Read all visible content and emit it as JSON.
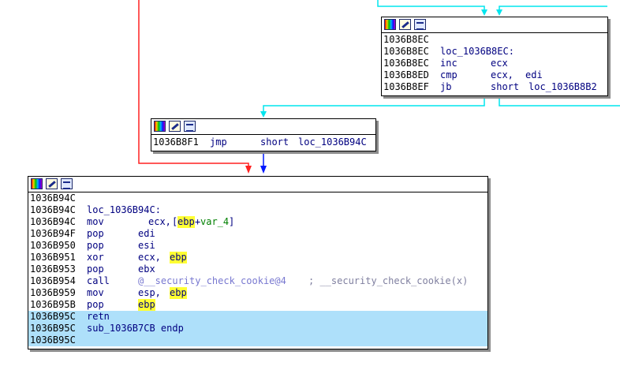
{
  "colors": {
    "edge_cyan": "#00e5ee",
    "edge_red": "#ff2020",
    "edge_blue": "#0018ff",
    "register_highlight": "#ffff33",
    "selected_row": "#aee0fa"
  },
  "node_toolbar_icons": [
    "color-palette-icon",
    "edit-node-icon",
    "graph-overview-icon"
  ],
  "node_a": {
    "lines": [
      {
        "addr": "1036B8EC"
      },
      {
        "addr": "1036B8EC",
        "label": "loc_1036B8EC:"
      },
      {
        "addr": "1036B8EC",
        "mnem": "inc",
        "op1": "ecx"
      },
      {
        "addr": "1036B8ED",
        "mnem": "cmp",
        "op1": "ecx,",
        "op2": "edi"
      },
      {
        "addr": "1036B8EF",
        "mnem": "jb",
        "op1": "short",
        "op2": "loc_1036B8B2"
      }
    ]
  },
  "node_b": {
    "lines": [
      {
        "addr": "1036B8F1",
        "mnem": "jmp",
        "op1": "short",
        "op2": "loc_1036B94C"
      }
    ]
  },
  "node_c": {
    "lines": [
      {
        "addr": "1036B94C"
      },
      {
        "addr": "1036B94C",
        "label": "loc_1036B94C:"
      },
      {
        "addr": "1036B94C",
        "mnem": "mov",
        "op1": "ecx,",
        "mem_open": "[",
        "reg": "ebp",
        "plus": "+",
        "var": "var_4",
        "mem_close": "]"
      },
      {
        "addr": "1036B94F",
        "mnem": "pop",
        "op1": "edi"
      },
      {
        "addr": "1036B950",
        "mnem": "pop",
        "op1": "esi"
      },
      {
        "addr": "1036B951",
        "mnem": "xor",
        "op1": "ecx,",
        "reg": "ebp"
      },
      {
        "addr": "1036B953",
        "mnem": "pop",
        "op1": "ebx"
      },
      {
        "addr": "1036B954",
        "mnem": "call",
        "func": "@__security_check_cookie@4",
        "comment": "; __security_check_cookie(x)"
      },
      {
        "addr": "1036B959",
        "mnem": "mov",
        "op1": "esp,",
        "reg": "ebp"
      },
      {
        "addr": "1036B95B",
        "mnem": "pop",
        "reg": "ebp"
      },
      {
        "addr": "1036B95C",
        "mnem": "retn"
      },
      {
        "addr": "1036B95C",
        "label": "sub_1036B7CB endp"
      },
      {
        "addr": "1036B95C"
      }
    ]
  }
}
